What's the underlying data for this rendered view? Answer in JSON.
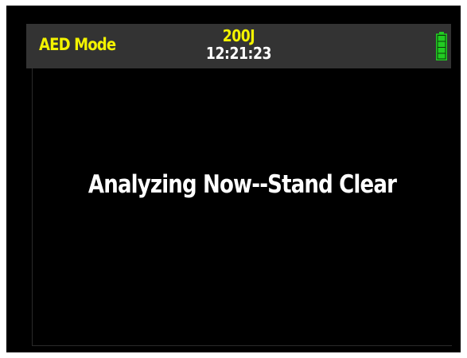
{
  "status_bar": {
    "mode": "AED Mode",
    "energy": "200J",
    "time": "12:21:23",
    "battery_icon": "battery-full-icon",
    "battery_level": 1.0
  },
  "main": {
    "message": "Analyzing Now--Stand Clear"
  },
  "colors": {
    "background": "#000000",
    "status_bar": "#333333",
    "accent_yellow": "#f3f300",
    "text": "#ffffff",
    "battery": "#22cc22"
  }
}
